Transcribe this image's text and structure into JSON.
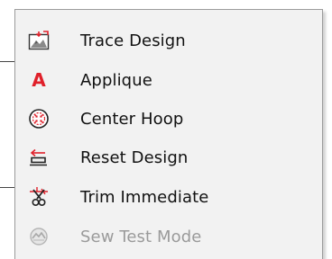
{
  "menu": {
    "items": [
      {
        "label": "Trace Design",
        "icon": "trace-design-icon",
        "enabled": true
      },
      {
        "label": "Applique",
        "icon": "applique-icon",
        "enabled": true,
        "icon_text": "A"
      },
      {
        "label": "Center Hoop",
        "icon": "center-hoop-icon",
        "enabled": true
      },
      {
        "label": "Reset Design",
        "icon": "reset-design-icon",
        "enabled": true
      },
      {
        "label": "Trim Immediate",
        "icon": "trim-immediate-icon",
        "enabled": true
      },
      {
        "label": "Sew Test Mode",
        "icon": "sew-test-mode-icon",
        "enabled": false
      }
    ]
  },
  "colors": {
    "menu_background": "#f2f2f2",
    "menu_border": "#9b9b9b",
    "accent_red": "#e0202a",
    "text": "#111111",
    "disabled_text": "#9a9a9a"
  }
}
